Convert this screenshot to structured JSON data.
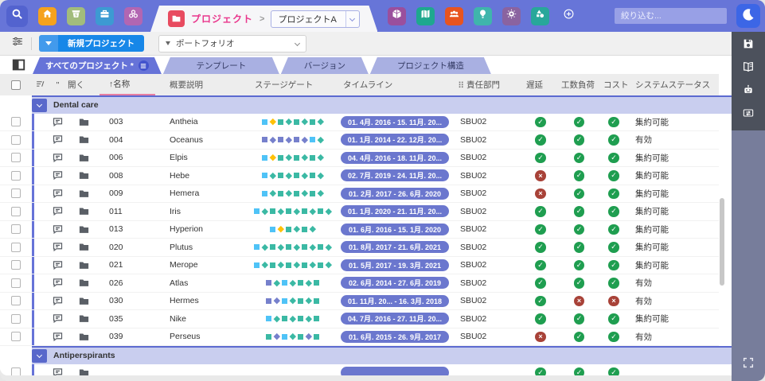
{
  "topbar": {
    "nav_icons": [
      "search",
      "home",
      "bucket-dollar",
      "briefcase",
      "org-cluster"
    ],
    "breadcrumb": {
      "folder_icon": "folder",
      "section_label": "プロジェクト",
      "separator": ">",
      "project_select_value": "プロジェクトA"
    },
    "action_icons": [
      "package-box",
      "map",
      "user-group",
      "lightbulb",
      "gear",
      "shapes",
      "add-circle"
    ],
    "filter_placeholder": "絞り込む...",
    "logo_icon": "crescent-moon"
  },
  "toolbar": {
    "tune_icon": "filter-sliders",
    "new_project_label": "新規プロジェクト",
    "portfolio_label": "ポートフォリオ"
  },
  "tabs": {
    "panel_toggle_icon": "panel-toggle",
    "active_label": "すべてのプロジェクト *",
    "active_badge_icon": "menu",
    "inactive": [
      "テンプレート",
      "バージョン",
      "プロジェクト構造"
    ]
  },
  "table": {
    "columns": {
      "comment": "\"",
      "open": "開く",
      "name": "↑名称",
      "desc": "概要説明",
      "stage": "ステージゲート",
      "timeline": "タイムライン",
      "dept": "責任部門",
      "delay": "遅延",
      "load": "工数負荷",
      "cost": "コスト",
      "status": "システムステータス"
    },
    "groups": [
      {
        "label": "Dental care",
        "rows": [
          {
            "id": "003",
            "name": "Antheia",
            "stage": [
              "c-s",
              "y-d",
              "t-s",
              "t-d",
              "t-s",
              "t-d",
              "t-s",
              "t-d"
            ],
            "timeline": "01. 4月. 2016 - 15. 11月. 20...",
            "dept": "SBU02",
            "delay": "ok",
            "load": "ok",
            "cost": "ok",
            "status": "集約可能"
          },
          {
            "id": "004",
            "name": "Oceanus",
            "stage": [
              "i-s",
              "i-d",
              "i-s",
              "i-d",
              "i-s",
              "i-d",
              "c-s",
              "t-d"
            ],
            "timeline": "01. 1月. 2014 - 22. 12月. 20...",
            "dept": "SBU02",
            "delay": "ok",
            "load": "ok",
            "cost": "ok",
            "status": "有効"
          },
          {
            "id": "006",
            "name": "Elpis",
            "stage": [
              "c-s",
              "y-d",
              "t-s",
              "t-d",
              "t-s",
              "t-d",
              "t-s",
              "t-d"
            ],
            "timeline": "04. 4月. 2016 - 18. 11月. 20...",
            "dept": "SBU02",
            "delay": "ok",
            "load": "ok",
            "cost": "ok",
            "status": "集約可能"
          },
          {
            "id": "008",
            "name": "Hebe",
            "stage": [
              "c-s",
              "t-d",
              "t-s",
              "t-d",
              "t-s",
              "t-d",
              "t-s",
              "t-d"
            ],
            "timeline": "02. 7月. 2019 - 24. 11月. 20...",
            "dept": "SBU02",
            "delay": "late",
            "load": "ok",
            "cost": "ok",
            "status": "集約可能"
          },
          {
            "id": "009",
            "name": "Hemera",
            "stage": [
              "c-s",
              "t-d",
              "t-s",
              "t-d",
              "t-s",
              "t-d",
              "t-s",
              "t-d"
            ],
            "timeline": "01. 2月. 2017 - 26. 6月. 2020",
            "dept": "SBU02",
            "delay": "late",
            "load": "ok",
            "cost": "ok",
            "status": "集約可能"
          },
          {
            "id": "011",
            "name": "Iris",
            "stage": [
              "c-s",
              "t-d",
              "t-s",
              "t-d",
              "t-s",
              "t-d",
              "t-s",
              "t-d",
              "t-s",
              "t-d"
            ],
            "timeline": "01. 1月. 2020 - 21. 11月. 20...",
            "dept": "SBU02",
            "delay": "ok",
            "load": "ok",
            "cost": "ok",
            "status": "集約可能"
          },
          {
            "id": "013",
            "name": "Hyperion",
            "stage": [
              "c-s",
              "y-d",
              "t-s",
              "t-d",
              "t-s",
              "t-d"
            ],
            "timeline": "01. 6月. 2016 - 15. 1月. 2020",
            "dept": "SBU02",
            "delay": "ok",
            "load": "ok",
            "cost": "ok",
            "status": "集約可能"
          },
          {
            "id": "020",
            "name": "Plutus",
            "stage": [
              "c-s",
              "t-d",
              "t-s",
              "t-d",
              "t-s",
              "t-d",
              "t-s",
              "t-d",
              "t-s",
              "t-d"
            ],
            "timeline": "01. 8月. 2017 - 21. 6月. 2021",
            "dept": "SBU02",
            "delay": "ok",
            "load": "ok",
            "cost": "ok",
            "status": "集約可能"
          },
          {
            "id": "021",
            "name": "Merope",
            "stage": [
              "c-s",
              "t-d",
              "t-s",
              "t-d",
              "t-s",
              "t-d",
              "t-s",
              "t-d",
              "t-s",
              "t-d"
            ],
            "timeline": "01. 5月. 2017 - 19. 3月. 2021",
            "dept": "SBU02",
            "delay": "ok",
            "load": "ok",
            "cost": "ok",
            "status": "集約可能"
          },
          {
            "id": "026",
            "name": "Atlas",
            "stage": [
              "i-s",
              "t-d",
              "c-s",
              "t-d",
              "t-s",
              "t-d",
              "t-s"
            ],
            "timeline": "02. 6月. 2014 - 27. 6月. 2019",
            "dept": "SBU02",
            "delay": "ok",
            "load": "ok",
            "cost": "ok",
            "status": "有効"
          },
          {
            "id": "030",
            "name": "Hermes",
            "stage": [
              "i-s",
              "i-d",
              "c-s",
              "t-d",
              "t-s",
              "t-d",
              "t-s"
            ],
            "timeline": "01. 11月. 20... - 16. 3月. 2018",
            "dept": "SBU02",
            "delay": "ok",
            "load": "late",
            "cost": "late",
            "status": "有効"
          },
          {
            "id": "035",
            "name": "Nike",
            "stage": [
              "c-s",
              "t-d",
              "t-s",
              "t-d",
              "t-s",
              "t-d",
              "t-s"
            ],
            "timeline": "04. 7月. 2016 - 27. 11月. 20...",
            "dept": "SBU02",
            "delay": "ok",
            "load": "ok",
            "cost": "ok",
            "status": "集約可能"
          },
          {
            "id": "039",
            "name": "Perseus",
            "stage": [
              "t-s",
              "i-d",
              "c-s",
              "t-d",
              "t-s",
              "i-d",
              "t-s"
            ],
            "timeline": "01. 6月. 2015 - 26. 9月. 2017",
            "dept": "SBU02",
            "delay": "late",
            "load": "ok",
            "cost": "ok",
            "status": "有効"
          }
        ]
      },
      {
        "label": "Antiperspirants",
        "rows": [
          {
            "id": "",
            "name": "",
            "stage": [],
            "timeline": "",
            "dept": "",
            "delay": "ok",
            "load": "ok",
            "cost": "ok",
            "status": ""
          }
        ]
      }
    ]
  },
  "sidebar": {
    "icons": [
      "save",
      "manual-book",
      "assistant-robot",
      "card-switch"
    ],
    "fullscreen_icon": "fullscreen"
  },
  "colors": {
    "topbar": "#6775d8",
    "accent": "#6673d8",
    "active_tab": "#6673d8",
    "inactive_tab": "#a9b0e2",
    "group_row_bg": "#c9ceef",
    "timeline_pill": "#6b77ce",
    "status_ok": "#1f9e50",
    "status_late": "#a84238",
    "stage_cyan": "#4fc3f7",
    "stage_teal": "#3bb9a4",
    "stage_yellow": "#ffc107",
    "stage_indigo": "#7680cc",
    "new_button": "#1787e8"
  }
}
